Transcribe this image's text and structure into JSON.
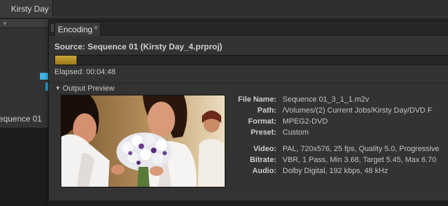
{
  "background": {
    "top_tab_title": "Kirsty Day",
    "sequence_label": "equence 01"
  },
  "panel": {
    "tab_label": "Encoding",
    "tab_close": "×",
    "source": "Source: Sequence 01 (Kirsty Day_4.prproj)",
    "progress": 0.055,
    "elapsed": "Elapsed: 00:04:48",
    "output_preview_label": "Output Preview",
    "output_preview_arrow": "▼",
    "details": [
      {
        "key": "File Name:",
        "value": "Sequence 01_3_1_1.m2v"
      },
      {
        "key": "Path:",
        "value": "/Volumes/(2) Current  Jobs/Kirsty Day/DVD F"
      },
      {
        "key": "Format:",
        "value": "MPEG2-DVD"
      },
      {
        "key": "Preset:",
        "value": "Custom"
      },
      {
        "key": "Video:",
        "value": "PAL, 720x576, 25 fps, Quality 5.0, Progressive"
      },
      {
        "key": "Bitrate:",
        "value": "VBR, 1 Pass, Min 3.68, Target 5.45, Max 6.70"
      },
      {
        "key": "Audio:",
        "value": "Dolby Digital, 192 kbps, 48 kHz"
      }
    ]
  },
  "colors": {
    "progress_fill": "#b8962c",
    "panel_bg": "#333333",
    "accent_marker": "#3fb6e6"
  }
}
